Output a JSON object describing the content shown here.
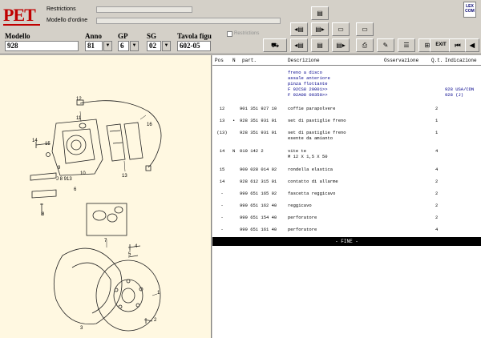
{
  "header": {
    "logo": "PET",
    "restrictions_label": "Restrictions",
    "order_model_label": "Modello d'ordine",
    "lex_logo": "LEX COM",
    "fields": {
      "modello_label": "Modello",
      "modello_value": "928",
      "anno_label": "Anno",
      "anno_value": "81",
      "gp_label": "GP",
      "gp_value": "6",
      "sg_label": "SG",
      "sg_value": "02",
      "tavola_label": "Tavola figu",
      "tavola_value": "602-05"
    },
    "checkbox_label": "Restrictions",
    "exit_label": "EXIT"
  },
  "columns": {
    "pos": "Pos",
    "n": "N",
    "part": "part.",
    "desc": "Descrizione",
    "obs": "Osservazione",
    "qty": "Q.t.",
    "ind": "Indicazione"
  },
  "group_header": {
    "line1": "freno a disco",
    "line2": "assale anteriore",
    "line3": "pinza flottante",
    "line4": "F 92CS8 20001>>",
    "line5": "F 92A08 00350>>",
    "ind1": "928 USA/CDN",
    "ind2": "928 (J)"
  },
  "rows": [
    {
      "pos": "12",
      "n": "",
      "part": "901 351 927 10",
      "desc": "coffie parapolvere",
      "desc2": "",
      "qty": "2"
    },
    {
      "pos": "13",
      "n": "•",
      "part": "928 351 931 01",
      "desc": "set di pastiglie freno",
      "desc2": "",
      "qty": "1"
    },
    {
      "pos": "(13)",
      "n": "",
      "part": "928 351 931 01",
      "desc": "set di pastiglie freno",
      "desc2": "esente da amianto",
      "qty": "1"
    },
    {
      "pos": "14",
      "n": "N",
      "part": "010 142 2",
      "desc": "vite te",
      "desc2": "M 12 X 1,5 X 50",
      "qty": "4"
    },
    {
      "pos": "15",
      "n": "",
      "part": "900 028 014 02",
      "desc": "rondella elastica",
      "desc2": "",
      "qty": "4"
    },
    {
      "pos": "14",
      "n": "",
      "part": "928 612 315 01",
      "desc": "contatto di allarme",
      "desc2": "",
      "qty": "2"
    },
    {
      "pos": "-",
      "n": "",
      "part": "999 651 165 02",
      "desc": "fascetta reggicavo",
      "desc2": "",
      "qty": "2"
    },
    {
      "pos": "-",
      "n": "",
      "part": "999 651 162 40",
      "desc": "reggicavo",
      "desc2": "",
      "qty": "2"
    },
    {
      "pos": "-",
      "n": "",
      "part": "999 651 154 40",
      "desc": "perforatore",
      "desc2": "",
      "qty": "2"
    },
    {
      "pos": "-",
      "n": "",
      "part": "999 651 161 40",
      "desc": "perforatore",
      "desc2": "",
      "qty": "4"
    }
  ],
  "fine_label": "- FINE -",
  "diagram_callouts": [
    "12",
    "16",
    "11",
    "10",
    "14",
    "15",
    "9",
    "13",
    "6",
    "J 8 913",
    "8",
    "7",
    "5",
    "4",
    "1",
    "2",
    "3"
  ],
  "icons": [
    "doc-arrow-icon",
    "first-page-icon",
    "next-page-icon",
    "book-icon",
    "car-icon",
    "prev-icon",
    "doc-icon",
    "page-next-icon",
    "display-icon",
    "print-icon",
    "edit-icon",
    "list-icon",
    "network-icon",
    "exit-icon",
    "begin-icon",
    "back-icon"
  ]
}
